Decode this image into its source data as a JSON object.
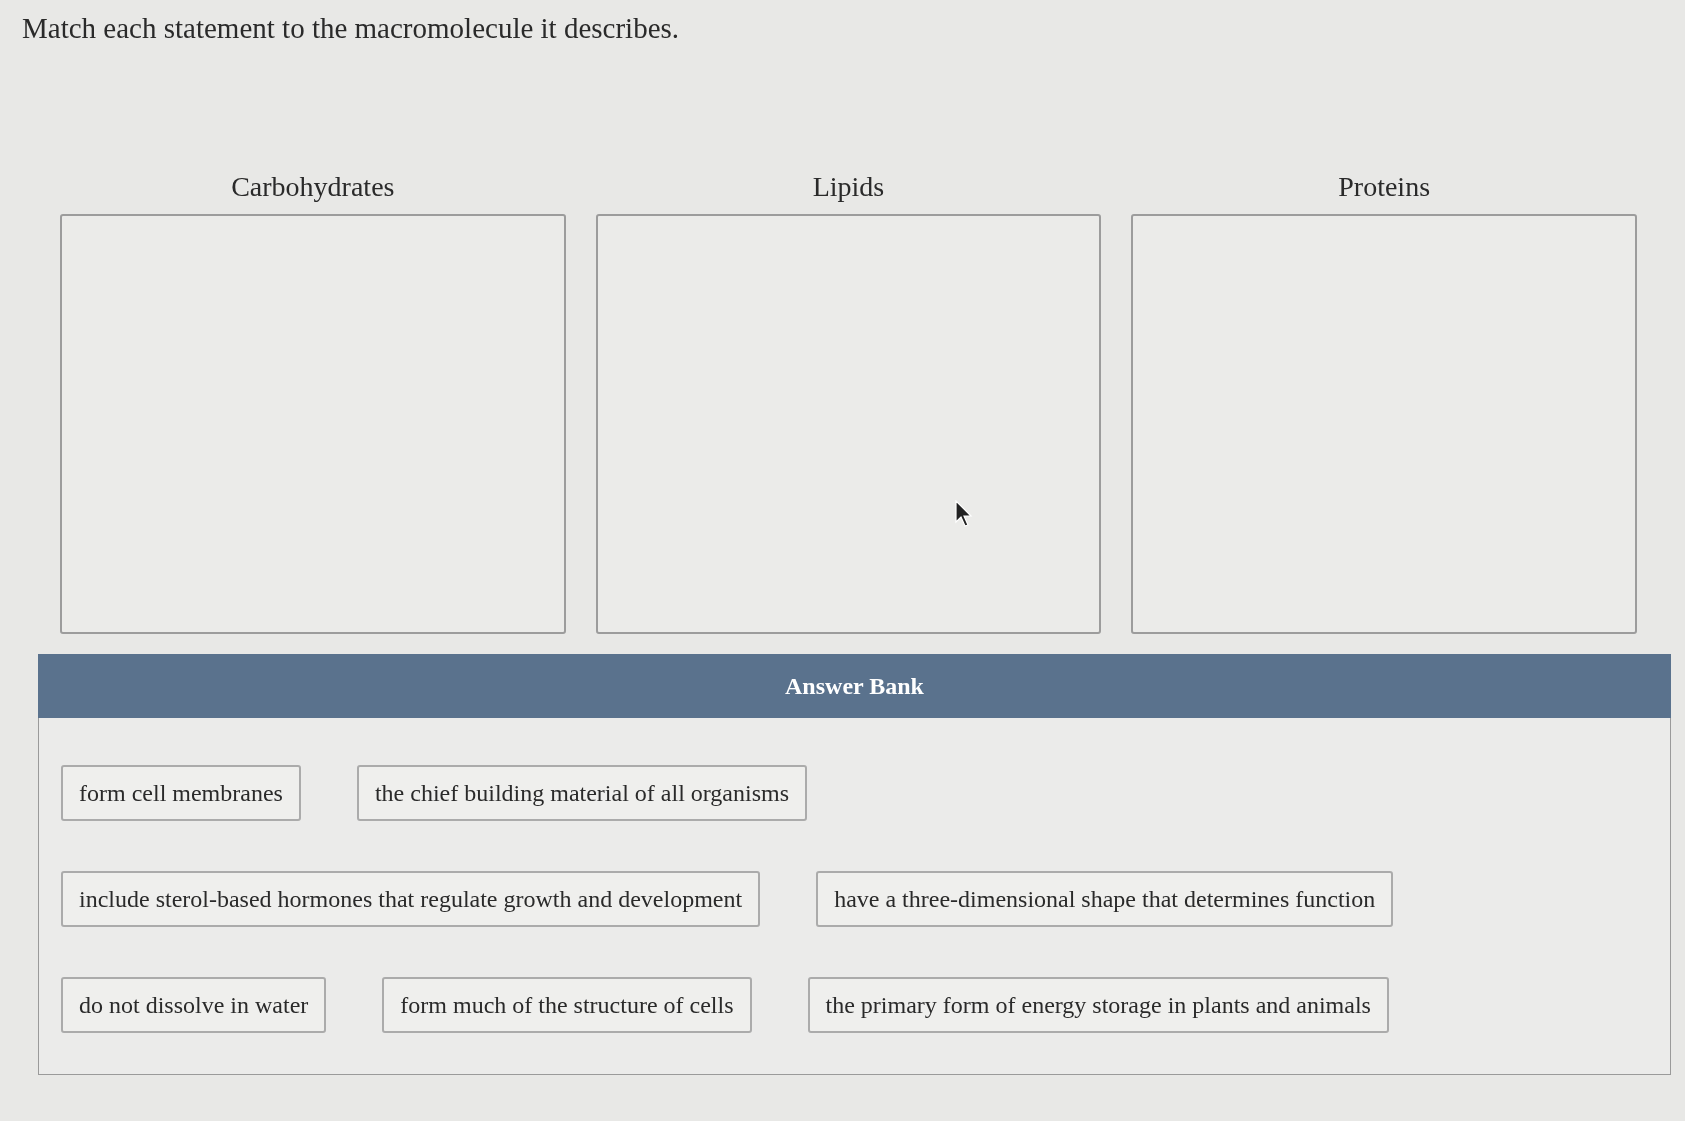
{
  "question": {
    "prompt": "Match each statement to the macromolecule it describes."
  },
  "categories": [
    {
      "label": "Carbohydrates"
    },
    {
      "label": "Lipids"
    },
    {
      "label": "Proteins"
    }
  ],
  "answer_bank": {
    "title": "Answer Bank",
    "rows": [
      {
        "items": [
          "form cell membranes",
          "the chief building material of all organisms"
        ]
      },
      {
        "items": [
          "include sterol-based hormones that regulate growth and development",
          "have a three-dimensional shape that determines function"
        ]
      },
      {
        "items": [
          "do not dissolve in water",
          "form much of the structure of cells",
          "the primary form of energy storage in plants and animals"
        ]
      }
    ]
  }
}
